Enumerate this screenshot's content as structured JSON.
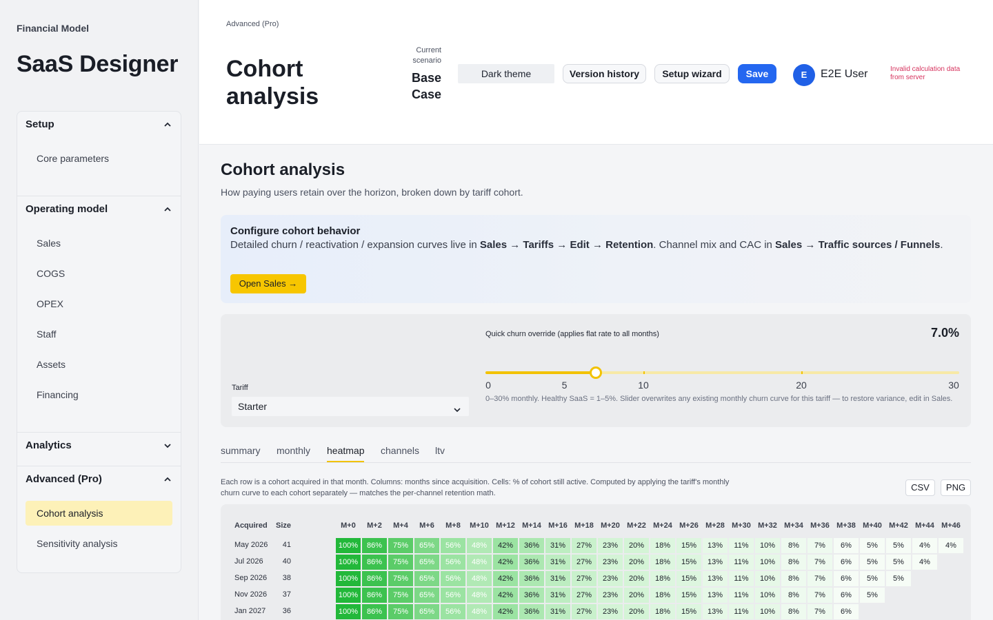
{
  "app": {
    "small_title": "Financial Model",
    "name": "SaaS Designer"
  },
  "sidebar": {
    "sections": [
      {
        "label": "Setup",
        "expanded": true,
        "items": [
          "Core parameters"
        ]
      },
      {
        "label": "Operating model",
        "expanded": true,
        "items": [
          "Sales",
          "COGS",
          "OPEX",
          "Staff",
          "Assets",
          "Financing"
        ]
      },
      {
        "label": "Analytics",
        "expanded": false,
        "items": []
      },
      {
        "label": "Advanced (Pro)",
        "expanded": true,
        "items": [
          "Cohort analysis",
          "Sensitivity analysis"
        ],
        "active_item": "Cohort analysis"
      }
    ]
  },
  "header": {
    "breadcrumb": "Advanced (Pro)",
    "title": "Cohort analysis",
    "scenario_label": "Current scenario",
    "scenario_value": "Base Case",
    "theme_button": "Dark theme",
    "version_history": "Version history",
    "setup_wizard": "Setup wizard",
    "save": "Save",
    "avatar_initial": "E",
    "user_name": "E2E User",
    "error": "Invalid calculation data from server"
  },
  "main": {
    "title": "Cohort analysis",
    "subtitle": "How paying users retain over the horizon, broken down by tariff cohort.",
    "info": {
      "title": "Configure cohort behavior",
      "text_1": "Detailed churn / reactivation / expansion curves live in ",
      "path_1": "Sales → Tariffs → Edit → Retention",
      "text_2": ". Channel mix and CAC in ",
      "path_2": "Sales → Traffic sources / Funnels",
      "text_3": ".",
      "button": "Open Sales →"
    },
    "controls": {
      "tariff_label": "Tariff",
      "tariff_value": "Starter",
      "slider_label": "Quick churn override (applies flat rate to all months)",
      "slider_value_text": "7.0%",
      "slider_value": 7.0,
      "slider_max": 30,
      "slider_ticks": [
        0,
        5,
        10,
        20,
        30
      ],
      "slider_help": "0–30% monthly. Healthy SaaS = 1–5%. Slider overwrites any existing monthly churn curve for this tariff — to restore variance, edit in Sales."
    },
    "tabs": [
      "summary",
      "monthly",
      "heatmap",
      "channels",
      "ltv"
    ],
    "active_tab": "heatmap",
    "heatmap": {
      "description": "Each row is a cohort acquired in that month. Columns: months since acquisition. Cells: % of cohort still active. Computed by applying the tariff's monthly churn curve to each cohort separately — matches the per-channel retention math.",
      "csv": "CSV",
      "png": "PNG",
      "acquired_header": "Acquired",
      "size_header": "Size",
      "columns": [
        "M+0",
        "M+2",
        "M+4",
        "M+6",
        "M+8",
        "M+10",
        "M+12",
        "M+14",
        "M+16",
        "M+18",
        "M+20",
        "M+22",
        "M+24",
        "M+26",
        "M+28",
        "M+30",
        "M+32",
        "M+34",
        "M+36",
        "M+38",
        "M+40",
        "M+42",
        "M+44",
        "M+46"
      ],
      "retention": [
        100,
        86,
        75,
        65,
        56,
        48,
        42,
        36,
        31,
        27,
        23,
        20,
        18,
        15,
        13,
        11,
        10,
        8,
        7,
        6,
        5,
        5,
        4,
        4
      ],
      "rows": [
        {
          "acquired": "May 2026",
          "size": "41",
          "cols": 24
        },
        {
          "acquired": "Jul 2026",
          "size": "40",
          "cols": 23
        },
        {
          "acquired": "Sep 2026",
          "size": "38",
          "cols": 22
        },
        {
          "acquired": "Nov 2026",
          "size": "37",
          "cols": 21
        },
        {
          "acquired": "Jan 2027",
          "size": "36",
          "cols": 20
        }
      ]
    }
  }
}
